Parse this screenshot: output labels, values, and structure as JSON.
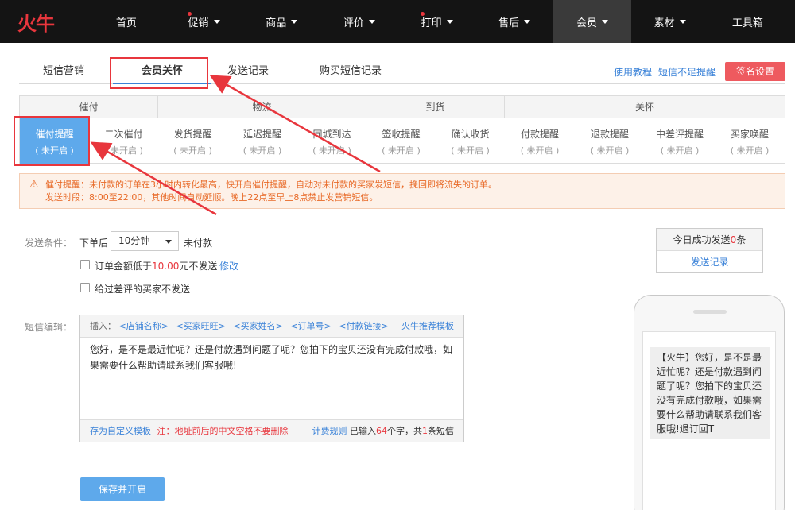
{
  "logo": "火牛",
  "nav": [
    {
      "label": "首页",
      "dot": false,
      "caret": false,
      "active": false
    },
    {
      "label": "促销",
      "dot": true,
      "caret": true,
      "active": false
    },
    {
      "label": "商品",
      "dot": false,
      "caret": true,
      "active": false
    },
    {
      "label": "评价",
      "dot": false,
      "caret": true,
      "active": false
    },
    {
      "label": "打印",
      "dot": true,
      "caret": true,
      "active": false
    },
    {
      "label": "售后",
      "dot": false,
      "caret": true,
      "active": false
    },
    {
      "label": "会员",
      "dot": false,
      "caret": true,
      "active": true
    },
    {
      "label": "素材",
      "dot": false,
      "caret": true,
      "active": false
    },
    {
      "label": "工具箱",
      "dot": false,
      "caret": false,
      "active": false
    }
  ],
  "subtabs": [
    "短信营销",
    "会员关怀",
    "发送记录",
    "购买短信记录"
  ],
  "toplinks": {
    "tutorial": "使用教程",
    "insufficient": "短信不足提醒",
    "sign": "签名设置"
  },
  "categories": [
    {
      "title": "催付",
      "items": [
        {
          "name": "催付提醒",
          "status": "( 未开启 )"
        },
        {
          "name": "二次催付",
          "status": "( 未开启 )"
        }
      ]
    },
    {
      "title": "物流",
      "items": [
        {
          "name": "发货提醒",
          "status": "( 未开启 )"
        },
        {
          "name": "延迟提醒",
          "status": "( 未开启 )"
        },
        {
          "name": "同城到达",
          "status": "( 未开启 )"
        }
      ]
    },
    {
      "title": "到货",
      "items": [
        {
          "name": "签收提醒",
          "status": "( 未开启 )"
        },
        {
          "name": "确认收货",
          "status": "( 未开启 )"
        }
      ]
    },
    {
      "title": "关怀",
      "items": [
        {
          "name": "付款提醒",
          "status": "( 未开启 )"
        },
        {
          "name": "退款提醒",
          "status": "( 未开启 )"
        },
        {
          "name": "中差评提醒",
          "status": "( 未开启 )"
        },
        {
          "name": "买家唤醒",
          "status": "( 未开启 )"
        }
      ]
    }
  ],
  "notice": {
    "line1": "催付提醒：未付款的订单在3小时内转化最高，快开启催付提醒，自动对未付款的买家发短信，挽回即将流失的订单。",
    "line2": "发送时段：8:00至22:00，其他时间自动延顺。晚上22点至早上8点禁止发营销短信。"
  },
  "form": {
    "condition_label": "发送条件：",
    "after_order": "下单后",
    "time_value": "10分钟",
    "unpaid": "未付款",
    "amount_prefix": "订单金额低于",
    "amount_value": "10.00",
    "amount_suffix": "元不发送",
    "modify": "修改",
    "no_bad_review": "给过差评的买家不发送",
    "edit_label": "短信编辑："
  },
  "editor": {
    "insert_label": "插入：",
    "inserts": [
      "<店铺名称>",
      "<买家旺旺>",
      "<买家姓名>",
      "<订单号>",
      "<付款链接>"
    ],
    "template": "火牛推荐模板",
    "content": "您好，是不是最近忙呢？还是付款遇到问题了呢？您拍下的宝贝还没有完成付款哦，如果需要什么帮助请联系我们客服哦!",
    "save_template": "存为自定义模板",
    "note": "注：地址前后的中文空格不要删除",
    "billing": "计费规则",
    "count_prefix": "已输入",
    "count_chars": "64",
    "count_mid": "个字，共",
    "count_msgs": "1",
    "count_suffix": "条短信"
  },
  "save_button": "保存并开启",
  "stats": {
    "prefix": "今日成功发送",
    "count": "0",
    "suffix": "条",
    "link": "发送记录"
  },
  "preview": "【火牛】您好，是不是最近忙呢？还是付款遇到问题了呢？您拍下的宝贝还没有完成付款哦，如果需要什么帮助请联系我们客服哦!退订回T"
}
